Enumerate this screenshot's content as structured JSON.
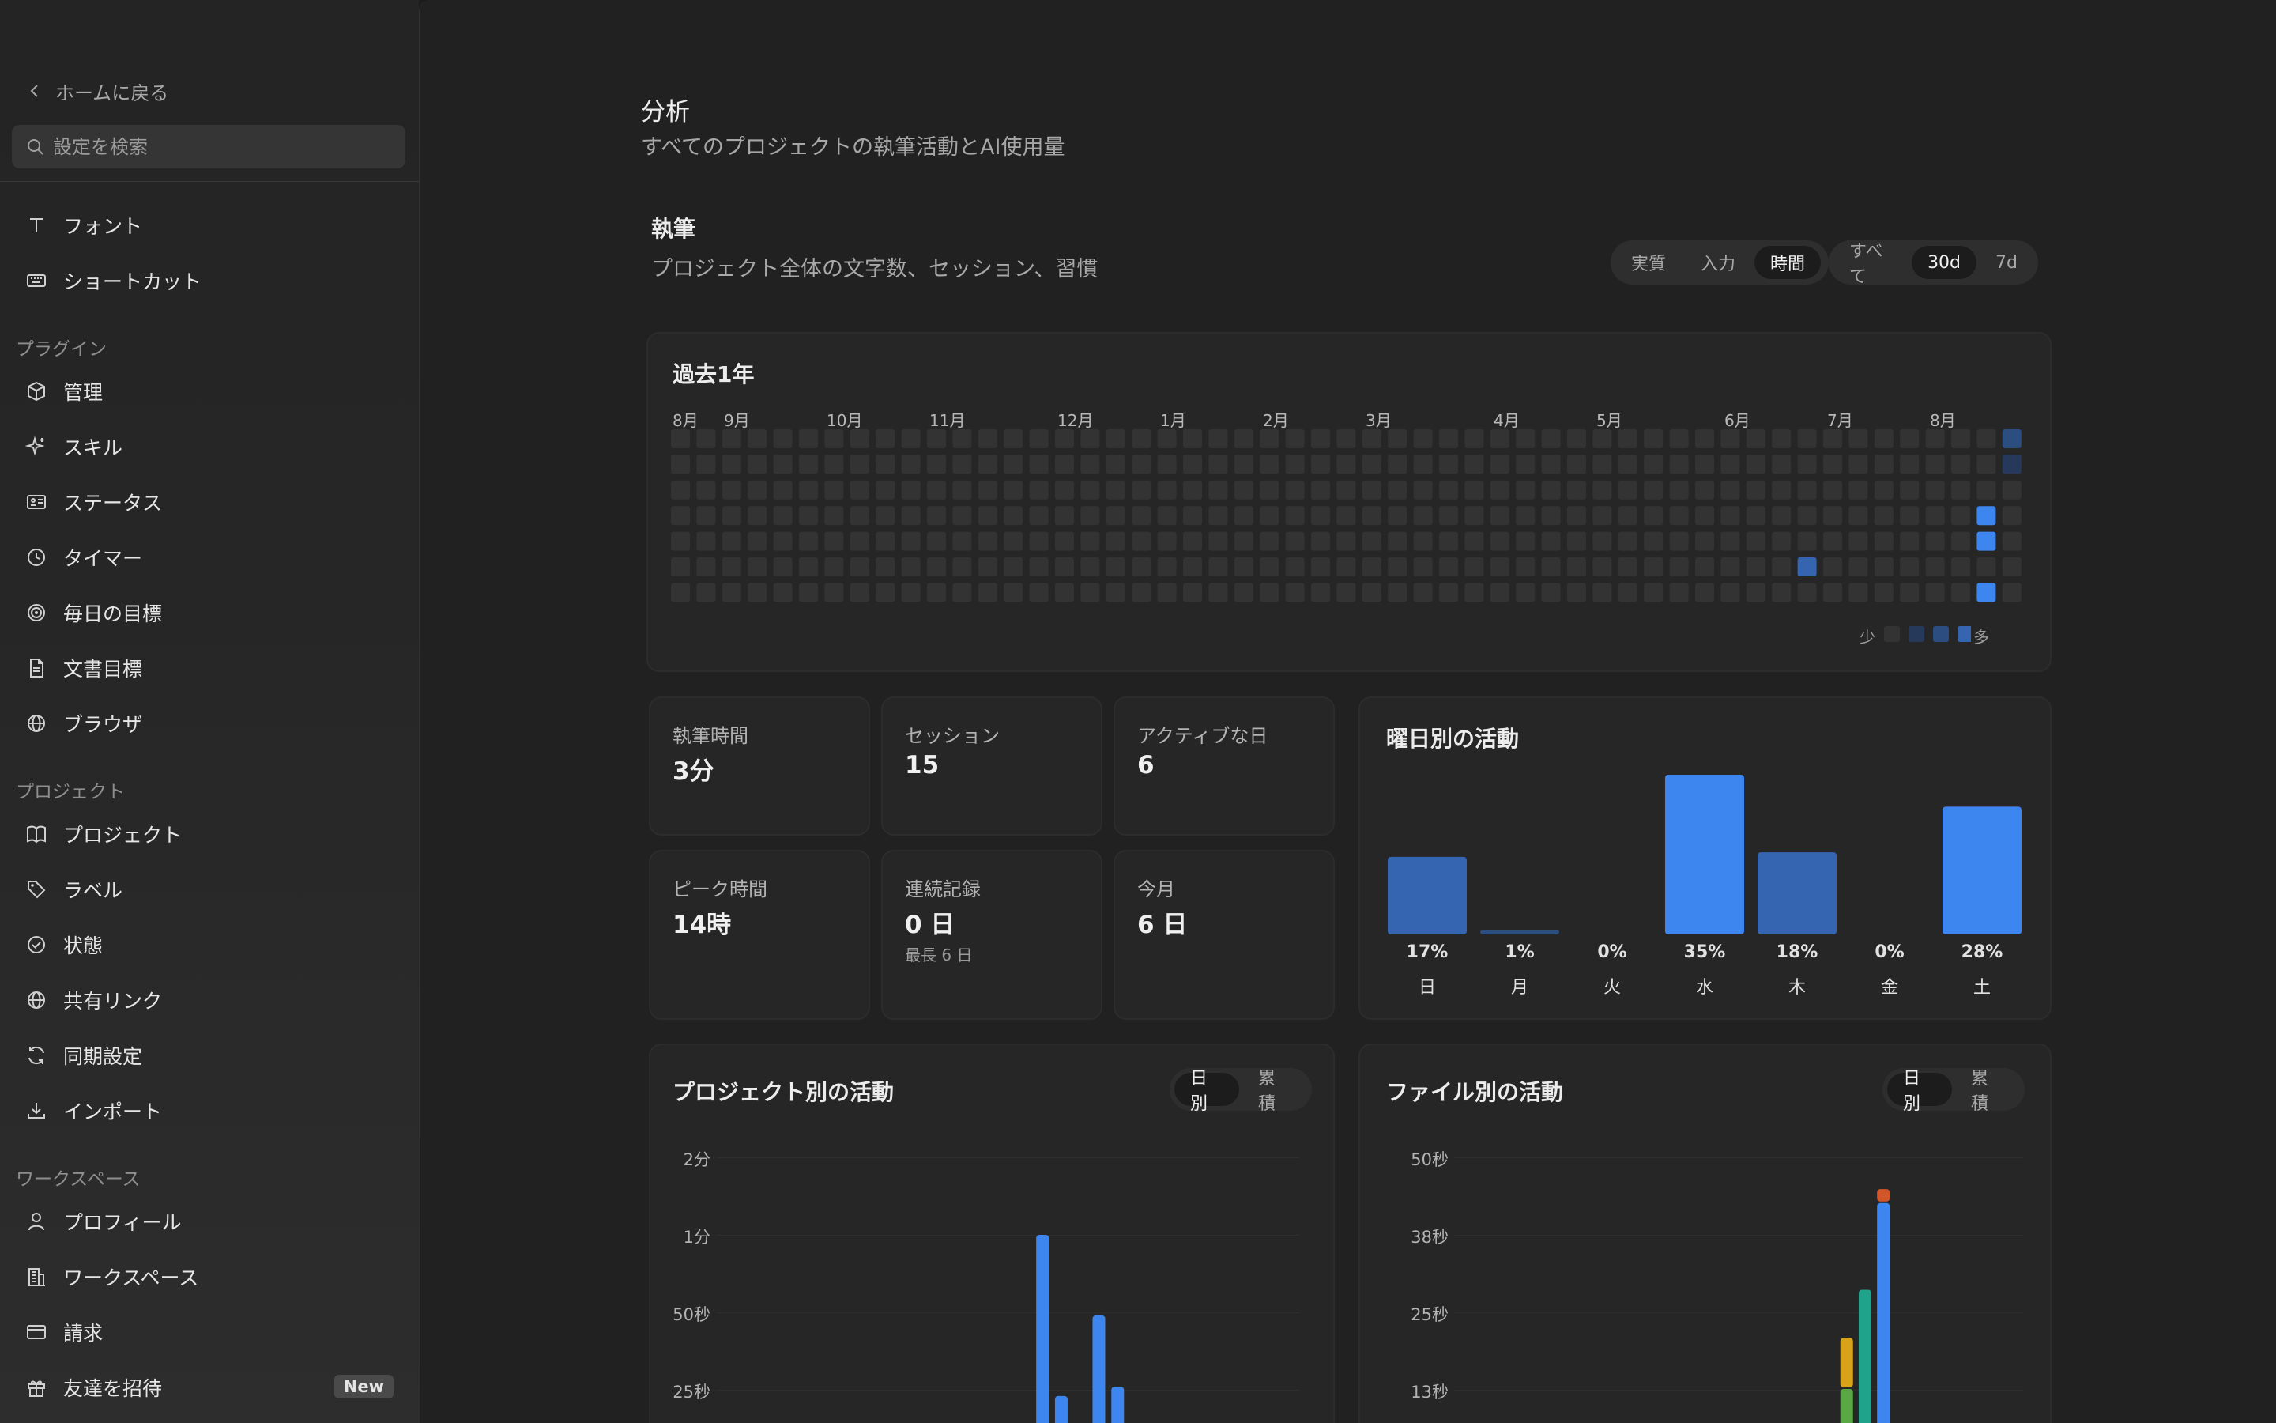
{
  "sidebar": {
    "back_label": "ホームに戻る",
    "search_placeholder": "設定を検索",
    "items_top": [
      {
        "label": "フォント",
        "icon": "type-icon"
      },
      {
        "label": "ショートカット",
        "icon": "keyboard-icon"
      }
    ],
    "section_plugins": "プラグイン",
    "items_plugins": [
      {
        "label": "管理",
        "icon": "cube-icon"
      },
      {
        "label": "スキル",
        "icon": "sparkle-icon"
      },
      {
        "label": "ステータス",
        "icon": "id-card-icon"
      },
      {
        "label": "タイマー",
        "icon": "clock-icon"
      },
      {
        "label": "毎日の目標",
        "icon": "target-icon"
      },
      {
        "label": "文書目標",
        "icon": "document-icon"
      },
      {
        "label": "ブラウザ",
        "icon": "globe-icon"
      }
    ],
    "section_projects": "プロジェクト",
    "items_projects": [
      {
        "label": "プロジェクト",
        "icon": "book-icon"
      },
      {
        "label": "ラベル",
        "icon": "tag-icon"
      },
      {
        "label": "状態",
        "icon": "check-circle-icon"
      },
      {
        "label": "共有リンク",
        "icon": "globe-icon"
      },
      {
        "label": "同期設定",
        "icon": "refresh-icon"
      },
      {
        "label": "インポート",
        "icon": "download-icon"
      }
    ],
    "section_workspace": "ワークスペース",
    "items_workspace": [
      {
        "label": "プロフィール",
        "icon": "user-icon"
      },
      {
        "label": "ワークスペース",
        "icon": "building-icon"
      },
      {
        "label": "請求",
        "icon": "credit-card-icon"
      },
      {
        "label": "友達を招待",
        "icon": "gift-icon",
        "badge": "New"
      }
    ]
  },
  "main": {
    "title": "分析",
    "subtitle": "すべてのプロジェクトの執筆活動とAI使用量",
    "writing": {
      "title": "執筆",
      "subtitle": "プロジェクト全体の文字数、セッション、習慣",
      "metric_options": [
        "実質",
        "入力",
        "時間"
      ],
      "metric_selected": "時間",
      "range_options": [
        "すべて",
        "30d",
        "7d"
      ],
      "range_selected": "30d"
    },
    "heatmap": {
      "title": "過去1年",
      "months": [
        "8月",
        "9月",
        "10月",
        "11月",
        "12月",
        "1月",
        "2月",
        "3月",
        "4月",
        "5月",
        "6月",
        "7月",
        "8月"
      ],
      "legend_less": "少",
      "legend_more": "多",
      "colors": [
        "#333333",
        "#27395a",
        "#2c4d80",
        "#3565b0",
        "#3d86f0"
      ]
    },
    "stats": [
      {
        "label": "執筆時間",
        "value": "3分"
      },
      {
        "label": "セッション",
        "value": "15"
      },
      {
        "label": "アクティブな日",
        "value": "6"
      },
      {
        "label": "ピーク時間",
        "value": "14時"
      },
      {
        "label": "連続記録",
        "value": "0 日",
        "note": "最長 6 日"
      },
      {
        "label": "今月",
        "value": "6 日"
      }
    ],
    "weekday": {
      "title": "曜日別の活動",
      "days": [
        "日",
        "月",
        "火",
        "水",
        "木",
        "金",
        "土"
      ],
      "percents": [
        "17%",
        "1%",
        "0%",
        "35%",
        "18%",
        "0%",
        "28%"
      ]
    },
    "project_chart": {
      "title": "プロジェクト別の活動",
      "toggle": [
        "日別",
        "累積"
      ],
      "toggle_selected": "日別",
      "y_ticks": [
        "2分",
        "1分",
        "50秒",
        "25秒"
      ]
    },
    "file_chart": {
      "title": "ファイル別の活動",
      "toggle": [
        "日別",
        "累積"
      ],
      "toggle_selected": "日別",
      "y_ticks": [
        "50秒",
        "38秒",
        "25秒",
        "13秒"
      ]
    }
  },
  "chart_data": [
    {
      "type": "heatmap",
      "title": "過去1年",
      "weeks": 53,
      "days_per_week": 7,
      "x_labels": [
        "8月",
        "9月",
        "10月",
        "11月",
        "12月",
        "1月",
        "2月",
        "3月",
        "4月",
        "5月",
        "6月",
        "7月",
        "8月"
      ],
      "cells": [
        {
          "week": 52,
          "day": 0,
          "level": 2
        },
        {
          "week": 52,
          "day": 1,
          "level": 1
        },
        {
          "week": 51,
          "day": 3,
          "level": 4
        },
        {
          "week": 51,
          "day": 4,
          "level": 4
        },
        {
          "week": 44,
          "day": 5,
          "level": 3
        },
        {
          "week": 51,
          "day": 6,
          "level": 4
        }
      ]
    },
    {
      "type": "bar",
      "title": "曜日別の活動",
      "categories": [
        "日",
        "月",
        "火",
        "水",
        "木",
        "金",
        "土"
      ],
      "values": [
        17,
        1,
        0,
        35,
        18,
        0,
        28
      ],
      "colors": [
        "#3565b0",
        "#2c4d80",
        "#333333",
        "#3d86f0",
        "#3565b0",
        "#333333",
        "#3d86f0"
      ]
    },
    {
      "type": "bar",
      "title": "プロジェクト別の活動",
      "y_ticks": [
        "2分",
        "1分",
        "50秒",
        "25秒"
      ],
      "bars": [
        {
          "day": 17,
          "value_sec": 60,
          "color": "#3d86f0"
        },
        {
          "day": 18,
          "value_sec": 23,
          "color": "#3d86f0"
        },
        {
          "day": 20,
          "value_sec": 49,
          "color": "#3d86f0"
        },
        {
          "day": 21,
          "value_sec": 26,
          "color": "#3d86f0"
        }
      ]
    },
    {
      "type": "bar",
      "title": "ファイル別の活動",
      "y_ticks": [
        "50秒",
        "38秒",
        "25秒",
        "13秒"
      ],
      "bars": [
        {
          "day": 21,
          "segments": [
            {
              "value_sec": 6,
              "color": "#5aa845"
            },
            {
              "value_sec": 8,
              "color": "#d9a21b"
            }
          ]
        },
        {
          "day": 22,
          "segments": [
            {
              "value_sec": 22,
              "color": "#1fa38a"
            }
          ]
        },
        {
          "day": 23,
          "segments": [
            {
              "value_sec": 36,
              "color": "#3d86f0"
            },
            {
              "value_sec": 2,
              "color": "#d2562a"
            }
          ]
        }
      ]
    }
  ]
}
